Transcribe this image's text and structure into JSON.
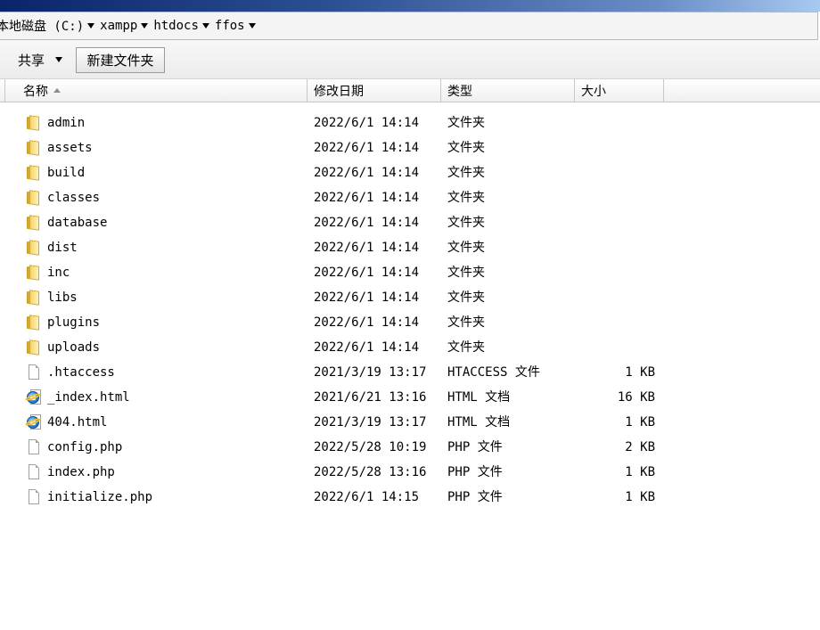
{
  "address": {
    "segments": [
      "本地磁盘 (C:)",
      "xampp",
      "htdocs",
      "ffos"
    ]
  },
  "toolbar": {
    "share_label": "共享",
    "new_folder_label": "新建文件夹"
  },
  "columns": {
    "name": "名称",
    "date": "修改日期",
    "type": "类型",
    "size": "大小"
  },
  "files": [
    {
      "name": "admin",
      "date": "2022/6/1 14:14",
      "type": "文件夹",
      "size": "",
      "icon": "folder-icon"
    },
    {
      "name": "assets",
      "date": "2022/6/1 14:14",
      "type": "文件夹",
      "size": "",
      "icon": "folder-icon"
    },
    {
      "name": "build",
      "date": "2022/6/1 14:14",
      "type": "文件夹",
      "size": "",
      "icon": "folder-icon"
    },
    {
      "name": "classes",
      "date": "2022/6/1 14:14",
      "type": "文件夹",
      "size": "",
      "icon": "folder-icon"
    },
    {
      "name": "database",
      "date": "2022/6/1 14:14",
      "type": "文件夹",
      "size": "",
      "icon": "folder-icon"
    },
    {
      "name": "dist",
      "date": "2022/6/1 14:14",
      "type": "文件夹",
      "size": "",
      "icon": "folder-icon"
    },
    {
      "name": "inc",
      "date": "2022/6/1 14:14",
      "type": "文件夹",
      "size": "",
      "icon": "folder-icon"
    },
    {
      "name": "libs",
      "date": "2022/6/1 14:14",
      "type": "文件夹",
      "size": "",
      "icon": "folder-icon"
    },
    {
      "name": "plugins",
      "date": "2022/6/1 14:14",
      "type": "文件夹",
      "size": "",
      "icon": "folder-icon"
    },
    {
      "name": "uploads",
      "date": "2022/6/1 14:14",
      "type": "文件夹",
      "size": "",
      "icon": "folder-icon"
    },
    {
      "name": ".htaccess",
      "date": "2021/3/19 13:17",
      "type": "HTACCESS 文件",
      "size": "1 KB",
      "icon": "file-icon"
    },
    {
      "name": "_index.html",
      "date": "2021/6/21 13:16",
      "type": "HTML 文档",
      "size": "16 KB",
      "icon": "ie-html-icon"
    },
    {
      "name": "404.html",
      "date": "2021/3/19 13:17",
      "type": "HTML 文档",
      "size": "1 KB",
      "icon": "ie-html-icon"
    },
    {
      "name": "config.php",
      "date": "2022/5/28 10:19",
      "type": "PHP 文件",
      "size": "2 KB",
      "icon": "file-icon"
    },
    {
      "name": "index.php",
      "date": "2022/5/28 13:16",
      "type": "PHP 文件",
      "size": "1 KB",
      "icon": "file-icon"
    },
    {
      "name": "initialize.php",
      "date": "2022/6/1 14:15",
      "type": "PHP 文件",
      "size": "1 KB",
      "icon": "file-icon"
    }
  ]
}
